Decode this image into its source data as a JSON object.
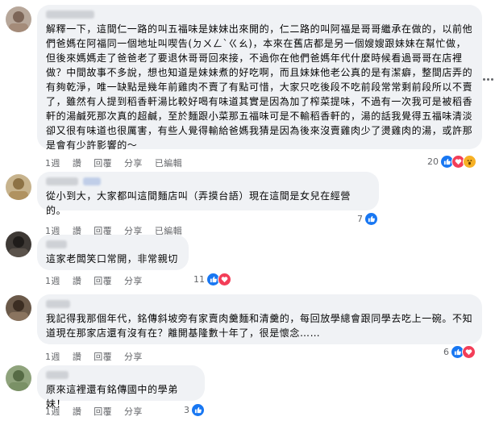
{
  "comments": [
    {
      "author": "",
      "text": "解釋一下，這間仁一路的叫五福味是妹妹出來開的，仁二路的叫阿福是哥哥繼承在做的，以前他們爸媽在阿福同一個地址叫喫告(ㄉㄨㄥˋㄍㄠ)，本來在舊店都是另一個嫂嫂跟妹妹在幫忙做，但後來媽媽走了爸爸老了要退休哥哥回來接，不過你在他們爸媽年代什麼時候看過哥哥在店裡做？中間故事不多說，想也知道是妹妹煮的好吃啊，而且妹妹他老公真的是有潔癖，整間店弄的有夠乾淨，唯一缺點是幾年前雞肉不賣了有點可惜，大家只吃後段不吃前段常常剩前段所以不賣了，雖然有人提到稻香軒湯比較好喝有味道其實是因為加了榨菜提味，不過有一次我可是被稻香軒的湯鹹死那次真的超鹹，至於麵跟小菜那五福味可是不輸稻香軒的，湯的話我覺得五福味清淡卻又很有味道也很厲害，有些人覺得輸給爸媽我猜是因為後來沒賣雞肉少了燙雞肉的湯，或許那是會有少許影響的～",
      "time": "1週",
      "like": "讚",
      "reply": "回覆",
      "share": "分享",
      "edited": "已編輯",
      "count": "20",
      "reactions": [
        "like-icon",
        "love-icon",
        "wow-icon"
      ]
    },
    {
      "author": "",
      "text": "從小到大，大家都叫這間麵店叫（弄摸台語）現在這間是女兒在經營的。",
      "time": "1週",
      "like": "讚",
      "reply": "回覆",
      "share": "分享",
      "edited": "已編輯",
      "count": "7",
      "reactions": [
        "like-icon"
      ]
    },
    {
      "author": "",
      "text": "這家老闆笑口常開，非常親切",
      "time": "1週",
      "like": "讚",
      "reply": "回覆",
      "share": "分享",
      "edited": "",
      "count": "11",
      "reactions": [
        "like-icon",
        "love-icon"
      ]
    },
    {
      "author": "",
      "text": "我記得我那個年代，銘傳斜坡旁有家賣肉羹麵和清羹的，每回放學總會跟同學去吃上一碗。不知道現在那家店還有沒有在？離開基隆數十年了，很是懷念……",
      "time": "1週",
      "like": "讚",
      "reply": "回覆",
      "share": "分享",
      "edited": "",
      "count": "6",
      "reactions": [
        "like-icon",
        "love-icon"
      ]
    },
    {
      "author": "",
      "text": "原來這裡還有銘傳國中的學弟妹！",
      "time": "1週",
      "like": "讚",
      "reply": "回覆",
      "share": "分享",
      "edited": "",
      "count": "3",
      "reactions": [
        "like-icon"
      ]
    }
  ],
  "colors": {
    "bubble": "#f0f2f5",
    "meta": "#65676b",
    "like": "#1877f2",
    "love": "#f33e58",
    "wow": "#f7b125"
  }
}
